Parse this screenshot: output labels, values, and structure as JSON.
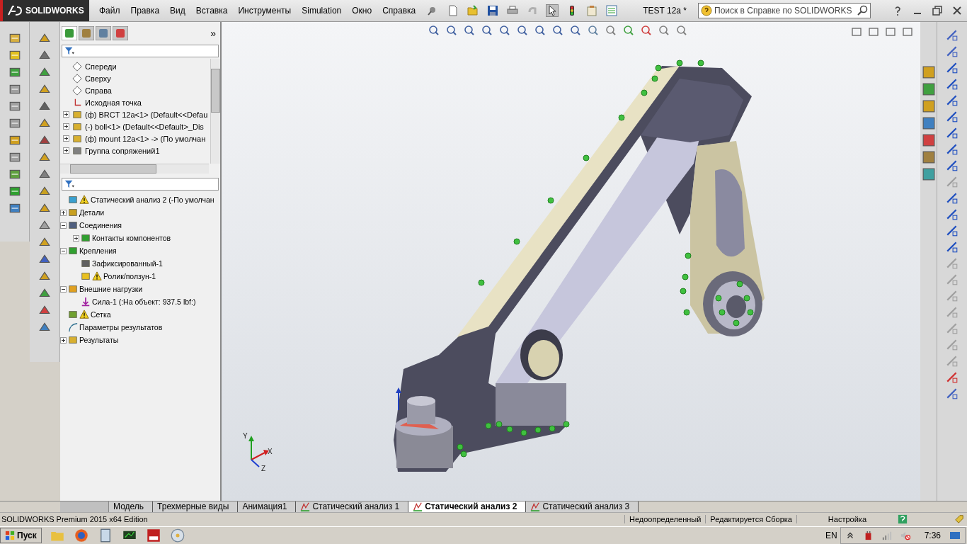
{
  "app": {
    "logo": "SOLIDWORKS",
    "menu": [
      "Файл",
      "Правка",
      "Вид",
      "Вставка",
      "Инструменты",
      "Simulation",
      "Окно",
      "Справка"
    ],
    "document_title": "TEST 12a *",
    "search": {
      "placeholder": "Поиск в Справке по SOLIDWORKS"
    }
  },
  "feature_manager": {
    "tabs": [
      {
        "kind": "feature",
        "selected": true
      },
      {
        "kind": "property",
        "selected": false
      },
      {
        "kind": "config",
        "selected": false
      },
      {
        "kind": "display",
        "selected": false
      }
    ],
    "more": "»",
    "tree": [
      {
        "label": "Спереди",
        "kind": "plane"
      },
      {
        "label": "Сверху",
        "kind": "plane"
      },
      {
        "label": "Справа",
        "kind": "plane"
      },
      {
        "label": "Исходная точка",
        "kind": "origin"
      },
      {
        "label": "(ф) BRCT 12a<1> (Default<<Defau",
        "kind": "part",
        "expanded": false
      },
      {
        "label": "(-) boll<1> (Default<<Default>_Dis",
        "kind": "part",
        "expanded": false
      },
      {
        "label": "(ф) mount 12a<1> -> (По умолчан",
        "kind": "part",
        "expanded": false
      },
      {
        "label": "Группа сопряжений1",
        "kind": "mates",
        "expanded": false
      }
    ]
  },
  "study_tree": [
    {
      "label": "Статический анализ 2 (-По умолчан",
      "kind": "study",
      "warning": true
    },
    {
      "label": "Детали",
      "kind": "parts",
      "warning": false,
      "expanded": false
    },
    {
      "label": "Соединения",
      "kind": "connections",
      "warning": false,
      "expanded": true,
      "children": [
        {
          "label": "Контакты компонентов",
          "kind": "contact",
          "warning": false,
          "expanded": false
        }
      ]
    },
    {
      "label": "Крепления",
      "kind": "fixtures",
      "warning": false,
      "expanded": true,
      "children": [
        {
          "label": "Зафиксированный-1",
          "kind": "fixed",
          "warning": false
        },
        {
          "label": "Ролик/ползун-1",
          "kind": "roller",
          "warning": true
        }
      ]
    },
    {
      "label": "Внешние нагрузки",
      "kind": "loads",
      "warning": false,
      "expanded": true,
      "children": [
        {
          "label": "Сила-1 (:На объект: 937.5 lbf:)",
          "kind": "force",
          "warning": false
        }
      ]
    },
    {
      "label": "Сетка",
      "kind": "mesh",
      "warning": true
    },
    {
      "label": "Параметры результатов",
      "kind": "result-options",
      "warning": false
    },
    {
      "label": "Результаты",
      "kind": "results",
      "warning": false,
      "expanded": false
    }
  ],
  "viewport": {
    "triad": {
      "x": "X",
      "y": "Y",
      "z": "Z"
    }
  },
  "sheet_tabs": [
    {
      "label": "Модель",
      "kind": "plain",
      "selected": false
    },
    {
      "label": "Трехмерные виды",
      "kind": "plain",
      "selected": false
    },
    {
      "label": "Анимация1",
      "kind": "plain",
      "selected": false
    },
    {
      "label": "Статический анализ 1",
      "kind": "study",
      "selected": false
    },
    {
      "label": "Статический анализ 2",
      "kind": "study",
      "selected": true
    },
    {
      "label": "Статический анализ 3",
      "kind": "study",
      "selected": false
    }
  ],
  "status_bar": {
    "edition": "SOLIDWORKS Premium 2015 x64 Edition",
    "fields": [
      "Недоопределенный",
      "Редактируется Сборка",
      "Настройка"
    ]
  },
  "taskbar": {
    "start": "Пуск",
    "language": "EN",
    "clock": "7:36"
  }
}
